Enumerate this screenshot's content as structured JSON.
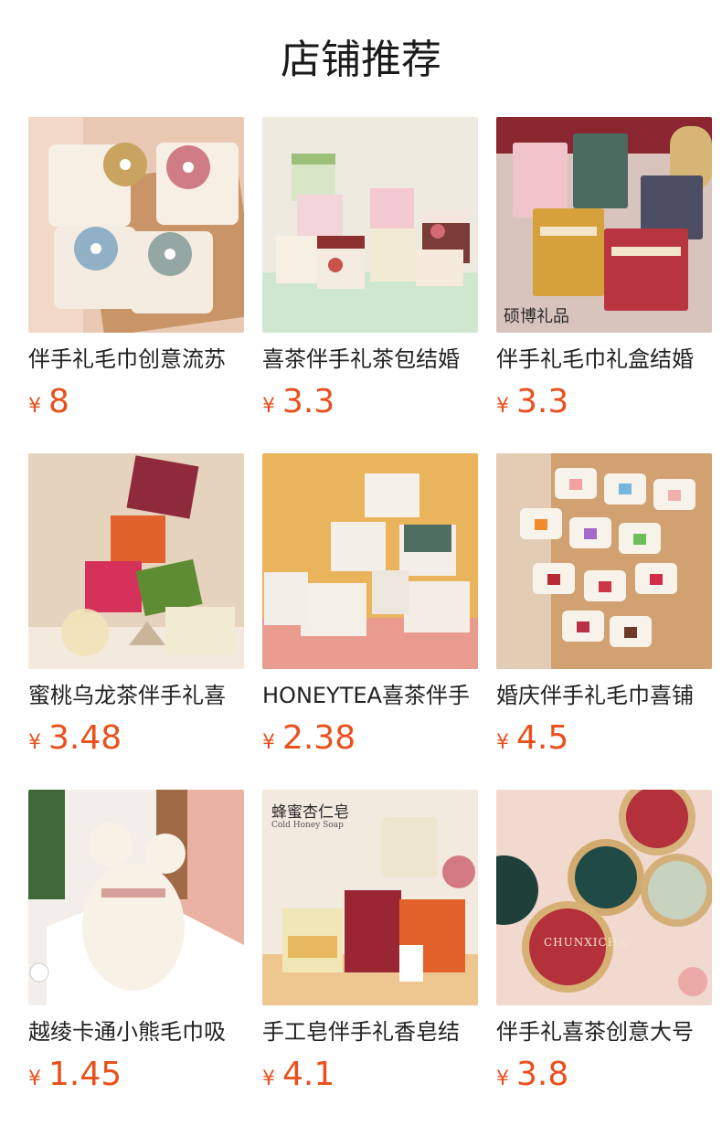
{
  "section_title": "店铺推荐",
  "products": [
    {
      "name": "伴手礼毛巾创意流苏",
      "currency": "¥",
      "price": "8",
      "image": "flower-towel-sachets"
    },
    {
      "name": "喜茶伴手礼茶包结婚",
      "currency": "¥",
      "price": "3.3",
      "image": "floral-tea-boxes"
    },
    {
      "name": "伴手礼毛巾礼盒结婚",
      "currency": "¥",
      "price": "3.3",
      "image": "towel-gift-boxes",
      "watermark": "硕博礼品"
    },
    {
      "name": "蜜桃乌龙茶伴手礼喜",
      "currency": "¥",
      "price": "3.48",
      "image": "peach-oolong-tea-boxes"
    },
    {
      "name": "HONEYTEA喜茶伴手",
      "currency": "¥",
      "price": "2.38",
      "image": "honey-tea-boxes"
    },
    {
      "name": "婚庆伴手礼毛巾喜铺",
      "currency": "¥",
      "price": "4.5",
      "image": "ribbon-towel-rolls"
    },
    {
      "name": "越绫卡通小熊毛巾吸",
      "currency": "¥",
      "price": "1.45",
      "image": "bear-towel"
    },
    {
      "name": "手工皂伴手礼香皂结",
      "currency": "¥",
      "price": "4.1",
      "image": "honey-soap",
      "image_text": "蜂蜜杏仁皂",
      "image_subtext": "Cold Honey Soap"
    },
    {
      "name": "伴手礼喜茶创意大号",
      "currency": "¥",
      "price": "3.8",
      "image": "chunxicha-tea-tins",
      "image_text": "CHUNXICHA"
    }
  ]
}
